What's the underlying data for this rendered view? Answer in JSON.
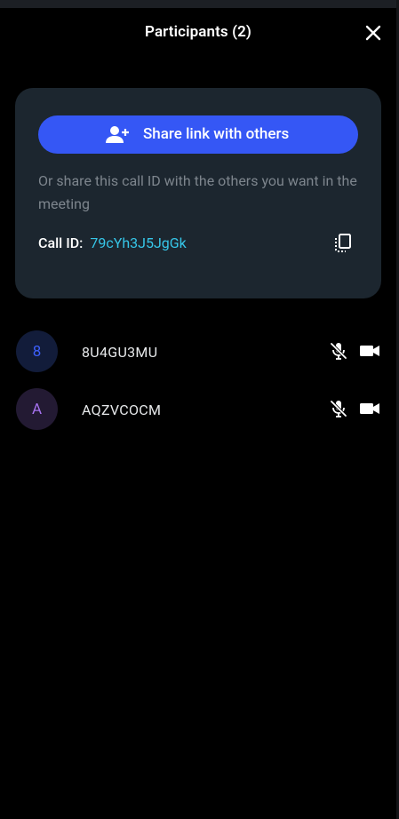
{
  "header": {
    "title": "Participants (2)"
  },
  "share": {
    "button_label": "Share link with others",
    "description": "Or share this call ID with the others you want in the meeting",
    "call_id_label": "Call ID:",
    "call_id_value": "79cYh3J5JgGk"
  },
  "participants": [
    {
      "initial": "8",
      "name": "8U4GU3MU"
    },
    {
      "initial": "A",
      "name": "AQZVCOCM"
    }
  ],
  "colors": {
    "accent": "#3557f5",
    "card": "#1c262f",
    "link": "#36c6e8"
  },
  "icons": [
    "close-icon",
    "person-add-icon",
    "copy-icon",
    "mic-off-icon",
    "videocam-icon"
  ]
}
